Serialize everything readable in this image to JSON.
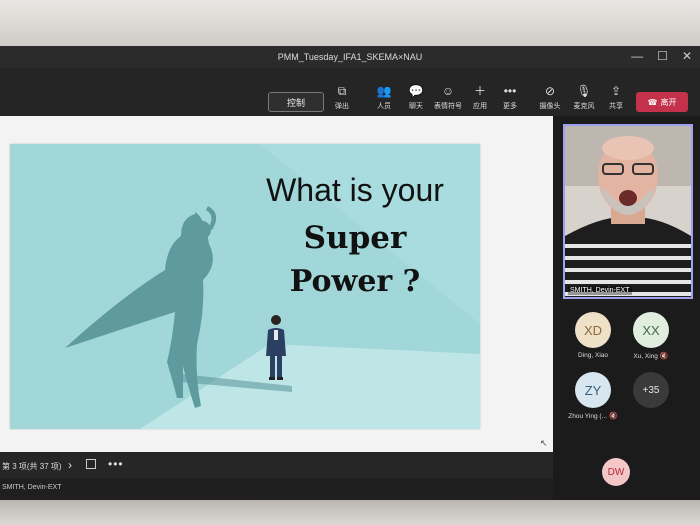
{
  "window": {
    "title": "PMM_Tuesday_IFA1_SKEMA×NAU"
  },
  "toolbar": {
    "control_label": "控制",
    "tools": [
      {
        "icon": "popout-icon",
        "label": "弹出"
      },
      {
        "icon": "people-icon",
        "label": "人员"
      },
      {
        "icon": "chat-icon",
        "label": "聊天"
      },
      {
        "icon": "reactions-icon",
        "label": "表情符号"
      },
      {
        "icon": "apps-icon",
        "label": "应用"
      },
      {
        "icon": "more-icon",
        "label": "更多"
      },
      {
        "icon": "camera-off-icon",
        "label": "摄像头"
      },
      {
        "icon": "mic-off-icon",
        "label": "麦克风"
      },
      {
        "icon": "share-icon",
        "label": "共享"
      }
    ],
    "leave_label": "离开"
  },
  "slide": {
    "line1": "What is your",
    "line2": "Super",
    "line3": "Power ?",
    "counter": "第 3 项(共 37 项)"
  },
  "presenter": "SMITH, Devin-EXT",
  "video": {
    "name": "SMITH, Devin-EXT"
  },
  "participants": [
    {
      "initials": "XD",
      "name": "Ding, Xiao",
      "bg": "#efe0c8",
      "fg": "#8a6a3a"
    },
    {
      "initials": "XX",
      "name": "Xu, Xing",
      "bg": "#dfeedd",
      "fg": "#3e6a44"
    },
    {
      "initials": "ZY",
      "name": "Zhou Ying (...",
      "bg": "#d7e6ef",
      "fg": "#3c5f78"
    },
    {
      "initials": "+35",
      "name": "",
      "bg": "#3a3a3a",
      "fg": "#e6e6e6"
    }
  ],
  "self": {
    "initials": "DW"
  }
}
